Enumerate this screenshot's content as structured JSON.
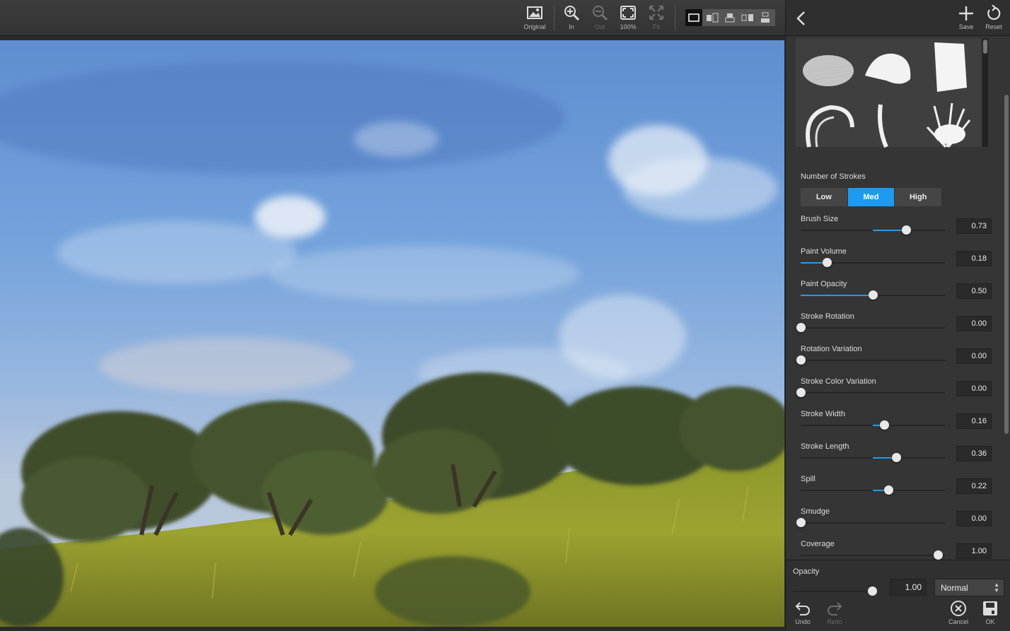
{
  "toolbar": {
    "buttons": [
      {
        "label": "Original",
        "icon": "image-icon",
        "enabled": true
      },
      {
        "label": "In",
        "icon": "zoom-in-icon",
        "enabled": true
      },
      {
        "label": "Out",
        "icon": "zoom-out-icon",
        "enabled": false
      },
      {
        "label": "100%",
        "icon": "actual-size-icon",
        "enabled": true
      },
      {
        "label": "Fit",
        "icon": "fit-icon",
        "enabled": false
      }
    ],
    "view_modes": [
      "single-view-icon",
      "split-vertical-icon",
      "split-horizontal-icon",
      "side-by-side-icon",
      "stacked-icon"
    ],
    "active_view": 0
  },
  "header": {
    "back_icon": "chevron-left-icon",
    "save_label": "Save",
    "reset_label": "Reset"
  },
  "strokes": {
    "label": "Number of Strokes",
    "options": [
      "Low",
      "Med",
      "High"
    ],
    "selected": 1
  },
  "sliders": [
    {
      "name": "Brush Size",
      "value": "0.73",
      "level": 0.73,
      "centered": true
    },
    {
      "name": "Paint Volume",
      "value": "0.18",
      "level": 0.18,
      "centered": false
    },
    {
      "name": "Paint Opacity",
      "value": "0.50",
      "level": 0.5,
      "centered": false
    },
    {
      "name": "Stroke Rotation",
      "value": "0.00",
      "level": 0.0,
      "centered": false
    },
    {
      "name": "Rotation Variation",
      "value": "0.00",
      "level": 0.0,
      "centered": false
    },
    {
      "name": "Stroke Color Variation",
      "value": "0.00",
      "level": 0.0,
      "centered": false
    },
    {
      "name": "Stroke Width",
      "value": "0.16",
      "level": 0.58,
      "centered": true
    },
    {
      "name": "Stroke Length",
      "value": "0.36",
      "level": 0.66,
      "centered": true
    },
    {
      "name": "Spill",
      "value": "0.22",
      "level": 0.61,
      "centered": true
    },
    {
      "name": "Smudge",
      "value": "0.00",
      "level": 0.0,
      "centered": false
    },
    {
      "name": "Coverage",
      "value": "1.00",
      "level": 0.95,
      "centered": false
    }
  ],
  "bottom": {
    "opacity_label": "Opacity",
    "opacity_value": "1.00",
    "opacity_level": 0.95,
    "blend_mode": "Normal",
    "undo_label": "Undo",
    "redo_label": "Redo",
    "cancel_label": "Cancel",
    "ok_label": "OK"
  },
  "colors": {
    "accent": "#1d9bf0",
    "panel": "#353535",
    "toolbar": "#383838"
  }
}
